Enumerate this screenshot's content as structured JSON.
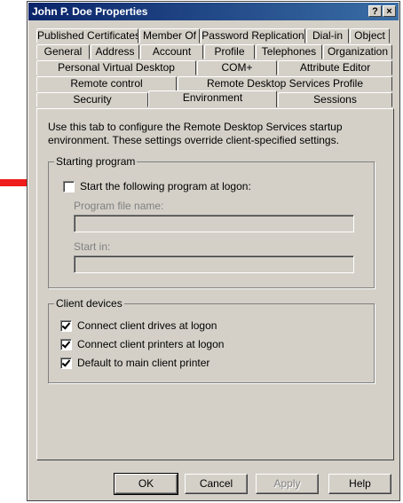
{
  "window": {
    "title": "John P. Doe Properties",
    "help_glyph": "?",
    "close_glyph": "×"
  },
  "tabs": {
    "row1": [
      "Published Certificates",
      "Member Of",
      "Password Replication",
      "Dial-in",
      "Object"
    ],
    "row2": [
      "General",
      "Address",
      "Account",
      "Profile",
      "Telephones",
      "Organization"
    ],
    "row3": [
      "Personal Virtual Desktop",
      "COM+",
      "Attribute Editor"
    ],
    "row4": [
      "Remote control",
      "Remote Desktop Services Profile"
    ],
    "row5": [
      "Security",
      "Environment",
      "Sessions"
    ],
    "active": "Environment"
  },
  "description": "Use this tab to configure the Remote Desktop Services startup environment. These settings override client-specified settings.",
  "starting_program": {
    "group_label": "Starting program",
    "checkbox_label": "Start the following program at logon:",
    "checked": false,
    "program_file_label": "Program file name:",
    "program_file_value": "",
    "start_in_label": "Start in:",
    "start_in_value": ""
  },
  "client_devices": {
    "group_label": "Client devices",
    "items": [
      {
        "label": "Connect client drives at logon",
        "checked": true
      },
      {
        "label": "Connect client printers at logon",
        "checked": true
      },
      {
        "label": "Default to main client printer",
        "checked": true
      }
    ]
  },
  "buttons": {
    "ok": "OK",
    "cancel": "Cancel",
    "apply": "Apply",
    "help": "Help"
  },
  "colors": {
    "arrow": "#ee1c1c",
    "titlebar": "#0a246a",
    "dialog_face": "#d4d0c8"
  },
  "annotations": {
    "arrow_icon": "red-arrow-icon"
  }
}
